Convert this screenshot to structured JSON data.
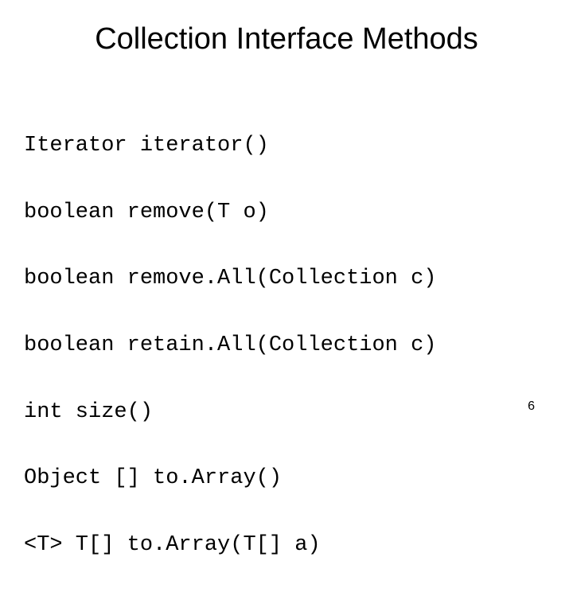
{
  "slide": {
    "title": "Collection Interface Methods",
    "code_lines": [
      "Iterator iterator()",
      "boolean remove(T o)",
      "boolean remove.All(Collection c)",
      "boolean retain.All(Collection c)",
      "int size()",
      "Object [] to.Array()",
      "<T> T[] to.Array(T[] a)"
    ],
    "page_number": "6"
  }
}
